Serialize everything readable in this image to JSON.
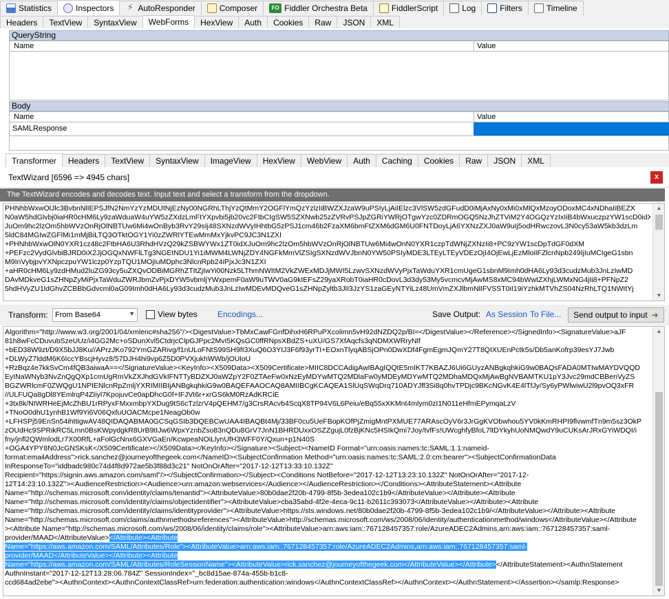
{
  "main_tabs": [
    {
      "label": "Statistics",
      "icon": "statistics-icon"
    },
    {
      "label": "Inspectors",
      "icon": "inspectors-icon"
    },
    {
      "label": "AutoResponder",
      "icon": "autoresponder-icon"
    },
    {
      "label": "Composer",
      "icon": "composer-icon"
    },
    {
      "label": "Fiddler Orchestra Beta",
      "icon": "orchestra-icon",
      "badge": "FO"
    },
    {
      "label": "FiddlerScript",
      "icon": "fiddlerscript-icon"
    },
    {
      "label": "Log",
      "icon": "log-icon"
    },
    {
      "label": "Filters",
      "icon": "filters-icon"
    },
    {
      "label": "Timeline",
      "icon": "timeline-icon"
    }
  ],
  "request_tabs": [
    "Headers",
    "TextView",
    "SyntaxView",
    "WebForms",
    "HexView",
    "Auth",
    "Cookies",
    "Raw",
    "JSON",
    "XML"
  ],
  "querystring": {
    "title": "QueryString",
    "col_name": "Name",
    "col_value": "Value"
  },
  "body": {
    "title": "Body",
    "col_name": "Name",
    "col_value": "Value",
    "row_name": "SAMLResponse"
  },
  "response_tabs": [
    "Transformer",
    "Headers",
    "TextView",
    "SyntaxView",
    "ImageView",
    "HexView",
    "WebView",
    "Auth",
    "Caching",
    "Cookies",
    "Raw",
    "JSON",
    "XML"
  ],
  "textwizard": {
    "title": "TextWizard [6596 => 4945 chars]",
    "close": "x",
    "info": "The TextWizard encodes and decodes text. Input text and select a transform from the dropdown."
  },
  "input_lines": [
    "PHNhbWxwOlJlc3BvbnNlIEPSJfN2NmYzYzMDUtNjEzNy00NGRhLThjYzQtMmY2OGFlYmQzYzlzIiBWZXJzaW9uPSIyLjAiIElzc3VlSW5zdGFudD0iMjAxNy0xMi0xMlQxMzoyODoxMC4xNDhaIiBEZX",
    "N0aW5hdGlvbj0iaHR0cHM6Ly9zaWduaW4uYW5zZXdzLmFtYXpvbi5jb20vc2FtbCIgSW5SZXNwb25zZVRvPSJpZGRiYWRjOTgwYzc0ZDRmOGQ5NzJhZTViM2Y4OGQzYzIxIiB4bWxuczpzYW1scD0idX",
    "JuOm9hc2lzOm5hbWVzOnRjOlNBTUw6Mi4wOnByb3RvY29sIj48SXNzdWVyIHhtbG5zPSJ1cm46b2FzaXM6bmFtZXM6dGM6U0FNTDoyLjA6YXNzZXJ0aW9uIj5odHRwczovL3N0cy53aW5kb3dzLm",
    "5ldC84MGIwZGFlMi1mMjBiLTQ3OTktOGY1Yi0zZWRlYTEwMmMxYjkvPC9JC3N1ZXI",
    "+PHNhbWxwOlN0YXR1cz48c2FtbHA6U3RhdHVzQ29kZSBWYWx1ZT0idXJuOm9hc2lzOm5hbWVzOnRjOlNBTUw6Mi4wOnN0YXR1czpTdWNjZXNzIi8+PC9zYW1scDpTdGF0dXM",
    "+PEFzc2VydGlvbiBJRD0iX2JjOGQxNWFlLTg3NGEtNDU1Yi1iMWM4LWNjZDY4NGFkMmVlZSIgSXNzdWVJbnN0YW50PSIyMDE3LTEyLTEyVDEzOjI4OjEwLjEzMloiIFZlcnNpb249IjIuMCIgeG1sbn",
    "M9InVybjpvYXNpczpuYW1lczp0YzpTQU1MOjIuMDphc3NlcnRpb24iPjxJc3N1ZXI",
    "+aHR0cHM6Ly9zdHMud2luZG93cy5uZXQvODBiMGRhZTItZjIwYi00Nzk5LThmNWItM2VkZWExMDJjMWI5LzwvSXNzdWVyPjxTaWduYXR1cmUgeG1sbnM9Imh0dHA6Ly93d3cudzMub3JnLzIwMD",
    "DAvMDkveG1sZHNpZyMiPjxTaWduZWRJbmZvPjxDYW5vbmljYWxpemF0aW9uTWV0aG9kIEFsZ29yaXRobT0iaHR0cDovL3d3dy53My5vcmcvMjAwMS8xMC94bWwtZXhjLWMxNG4jIi8+PFNpZ2",
    "5hdHVyZU1ldGhvZCBBbGdvcml0aG09Imh0dHA6Ly93d3cudzMub3JnLzIwMDEvMDQveG1sZHNpZyltb3JlI3JzYS1zaGEyNTYiLz48UmVmZXJlbmNlIFVSST0iI19iYzhkMTVhZS04NzRhLTQ1NWItYj"
  ],
  "transform_bar": {
    "label": "Transform:",
    "selected": "From Base64",
    "view_bytes": "View bytes",
    "encodings": "Encodings...",
    "save_output": "Save Output:",
    "as_session": "As Session",
    "to_file": "To File...",
    "send_output": "Send output to input"
  },
  "output_lines": [
    [
      {
        "t": "Algorithm=\"http://www.w3.org/2001/04/xmlenc#sha256\"/><DigestValue>TbMxCawFGnfDihxH6RPuPXcolimn5vH92dNZDQ2p/BI=</DigestValue></Reference></SignedInfo><SignatureValue>aJF"
      }
    ],
    [
      {
        "t": "81h8wFcCDuvubSzeUUz/i4GG2Mc+oSDunXvl5CtdrjcClpGJPpc2MvI5KQsGC0ffRNpsXBdZS+uXU/GS7XfAqcfs3qNDMXWRryNlf"
      }
    ],
    [
      {
        "t": "+bED38W9zt/D9X5bJJ8Ku//APrzJKo792YmGZARivg/f1nULoFNtS99SH9fI3XuQ6O3YIJ3F6f93yrTI+EOxnTlyqABSjOPn0DwXDf4FgmEgmJQmY27T8QIXUEnPctk5s/Db5anKofrp39esYJ7Jwb"
      }
    ],
    [
      {
        "t": "+DLWyZ7lddM6K6IccYBscjHyvz8/57DJH4hi9vp6Z5D0PVXjukhWWb/jOUloU"
      }
    ],
    [
      {
        "t": "+RzBqz4e7kkSvCm4fQB3aiwaA==</SignatureValue><KeyInfo><X509Data><X509Certificate>MIIC8DCCAdigAwIBAgIQQtE5mIKT7KBAZJ6Ui6GUyzANBgkqhkiG9w0BAQsFADA0MTIwMAYDVQQD"
      }
    ],
    [
      {
        "t": "EyINaWNyb3NvZnQgQXp1cmUgRmVkZXJhdGVkIFNTTyBDZXJ0aWZpY2F0ZTAeFw0xNzEyMDYwMTQ2MDlaFw0yMDEyMDYwMTQ2MDhaMDQxMjAwBgNVBAMTKU1pY3Jvc29mdCBBenVyZS"
      }
    ],
    [
      {
        "t": "BGZWRlcmF0ZWQgU1NPIENlcnRpZmljYXRIMIIBIjANBgkqhkiG9w0BAQEFAAOCAQ8AMIIBCgKCAQEA1SlUqSWqDrq710ADYJff3Si8q0hvTPDjc9BKcNGvK4E4lTfJy/Sy6yPWlwiwU2l9pvOQ3xFR"
      }
    ],
    [
      {
        "t": "//ULFUQa8gDl8YEmlrqP4ZIiyl7KpojuvCe0apDhcG0f+IFJVt6r+xrGS6kM0RzAdKRCiE"
      }
    ],
    [
      {
        "t": "+3tx8k/NIWRHeEjMcZhBU1rRPyxFMxxmbpYXDug9tS6cTzlzrV4pQEHM7/g3CrsRAcvb4ScqX8TP94V6L6Peiu/eBq55xXKMnt4mlym0zI1N011eHfmEPymqaLzV"
      }
    ],
    [
      {
        "t": "+TNoO0dhU1ynhB1Wf9Yi6V06QxfuUOACMcpe1NeagOb0w"
      }
    ],
    [
      {
        "t": "+LFHSPj59EnSn54ihttigwAV48QIDAQABMA0GCSqGSIb3DQEBCwUAA4IBAQBt4Mj/33BF0cu5UeFBopKOfPjZmigMntPXMUE77ARAscOyV6r3JrGgKVObwhou5YV0kKmRHPI9flvwmfTn9m5sz3OkP"
      }
    ],
    [
      {
        "t": "zOUdHc9SPRikRC5Lmn0BsKWpydgkR8UrB9tIJw6WpxYznbZso83nQDu8GrV7JnN1BHRDUxxOSZZgujL0fzBjKNc5HSIkQmi7Joy/tvfFs!UWcghfyBfoL7ltDYkyhUoNMQwdY9uCUKsArJRxGYiWDQI/i"
      }
    ],
    [
      {
        "t": "fny/jnfl2QWmlodLr7X00RfL+aFolGcNnx6GXVGaEn/KcwpeaNOiLlynUfH3WFF0Y/Qxun+p1N40S"
      }
    ],
    [
      {
        "t": "+OGA4YPY8N0JcGNSKsK</X509Certificate></X509Data></KeyInfo></Signature><Subject><NameID Format=\"urn:oasis:names:tc:SAML:1.1:nameid-"
      }
    ],
    [
      {
        "t": "format:emailAddress\">rick.sanchez@journeyofthegeek.com</NameID><SubjectConfirmation Method=\"urn:oasis:names:tc:SAML:2.0:cm:bearer\"><SubjectConfirmationData"
      }
    ],
    [
      {
        "t": "InResponseTo=\"iddbadc980c74d4f8d972ae5b3f88d3c21\" NotOnOrAfter=\"2017-12-12T13:33:10.132Z\""
      }
    ],
    [
      {
        "t": "Recipient=\"https://signin.aws.amazon.com/saml\"/></SubjectConfirmation></Subject><Conditions NotBefore=\"2017-12-12T13:23:10.132Z\" NotOnOrAfter=\"2017-12-"
      }
    ],
    [
      {
        "t": "12T14:23:10.132Z\"><AudienceRestriction><Audience>urn:amazon:webservices</Audience></AudienceRestriction></Conditions><AttributeStatement><Attribute"
      }
    ],
    [
      {
        "t": "Name=\"http://schemas.microsoft.com/identity/claims/tenantid\"><AttributeValue>80b0dae2f20b-4799-8f5b-3edea102c1b9</AttributeValue></Attribute><Attribute"
      }
    ],
    [
      {
        "t": "Name=\"http://schemas.microsoft.com/identity/claims/objectidentifier\"><AttributeValue>cba35abd-4f2e-4eca-9c11-b2611c393073</AttributeValue></Attribute><Attribute"
      }
    ],
    [
      {
        "t": "Name=\"http://schemas.microsoft.com/identity/claims/identityprovider\"><AttributeValue>https://sts.windows.net/80b0dae2f20b-4799-8f5b-3edea102c1b9/</AttributeValue></Attribute><Attribute"
      }
    ],
    [
      {
        "t": "Name=\"http://schemas.microsoft.com/claims/authnmethodsreferences\"><AttributeValue>http://schemas.microsoft.com/ws/2008/06/identity/authenticationmethod/windows</AttributeValue></Attribute"
      }
    ],
    [
      {
        "t": "><Attribute Name=\"http://schemas.microsoft.com/ws/2008/06/identity/claims/role\"><AttributeValue>arn:aws:iam::767128457357:role/AzureADEC2Admins,arn:aws:iam::767128457357:saml-"
      }
    ],
    [
      {
        "t": "provider/MAAD</AttributeValue>"
      },
      {
        "t": "</Attribute><Attribute",
        "hl": true
      }
    ],
    [
      {
        "t": "Name=\"https://aws.amazon.com/SAML/Attributes/Role\"><AttributeValue>arn:aws:iam::767128457357:role/AzureADEC2Admins,arn:aws:iam::767128457357:saml-",
        "hl": true
      }
    ],
    [
      {
        "t": "provider/MAAD</AttributeValue></Attribute><Attribute",
        "hl": true
      }
    ],
    [
      {
        "t": "Name=\"https://aws.amazon.com/SAML/Attributes/RoleSessionName\"><AttributeValue>rick.sanchez@journeyofthegeek.com</AttributeValue></Attribute>",
        "hl": true
      },
      {
        "t": "</AttributeStatement><AuthnStatement"
      }
    ],
    [
      {
        "t": "AuthnInstant=\"2017-12-12T13:28:06.784Z\" SessionIndex=\"_bc8d15ae-874a-455b-b1c8-"
      }
    ],
    [
      {
        "t": "ccd684ad2ebe\"><AuthnContext><AuthnContextClassRef>urn:federation:authentication:windows</AuthnContextClassRef></AuthnContext></AuthnStatement></Assertion></samlp:Response>"
      }
    ]
  ],
  "colors": {
    "selection": "#3399ff",
    "section_header": "#c9d3e6",
    "dark_bar": "#707070",
    "link": "#1a55c8"
  }
}
